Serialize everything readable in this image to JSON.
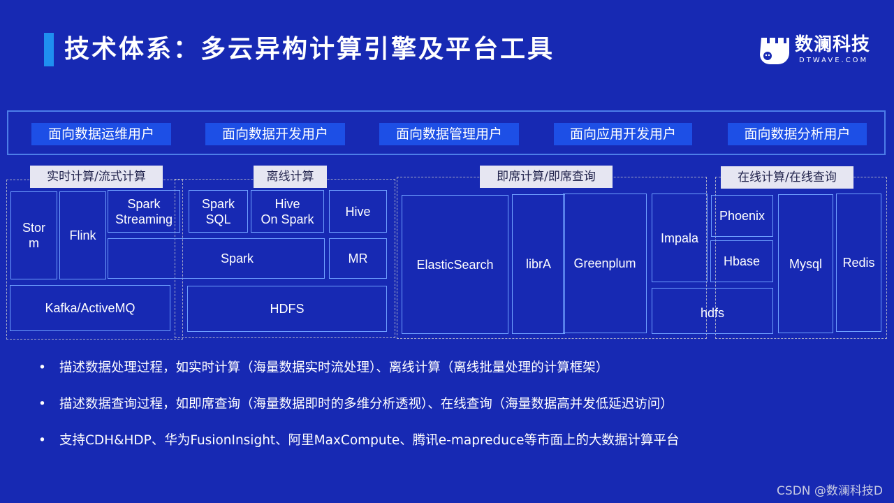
{
  "header": {
    "title": "技术体系：多云异构计算引擎及平台工具",
    "accent_color": "#1f8ff0",
    "logo": {
      "icon": "sloth-logo-icon",
      "name": "数澜科技",
      "domain": "DTWAVE.COM"
    }
  },
  "user_types": [
    "面向数据运维用户",
    "面向数据开发用户",
    "面向数据管理用户",
    "面向应用开发用户",
    "面向数据分析用户"
  ],
  "groups": {
    "realtime": "实时计算/流式计算",
    "offline": "离线计算",
    "adhoc": "即席计算/即席查询",
    "online": "在线计算/在线查询"
  },
  "components": {
    "storm": "Stor\nm",
    "flink": "Flink",
    "spark_streaming": "Spark\nStreaming",
    "spark_sql": "Spark\nSQL",
    "hive_on_spark": "Hive\nOn Spark",
    "hive": "Hive",
    "spark": "Spark",
    "mr": "MR",
    "kafka": "Kafka/ActiveMQ",
    "hdfs": "HDFS",
    "elasticsearch": "ElasticSearch",
    "libra": "librA",
    "greenplum": "Greenplum",
    "impala": "Impala",
    "hdfs_lower": "hdfs",
    "phoenix": "Phoenix",
    "hbase": "Hbase",
    "mysql": "Mysql",
    "redis": "Redis"
  },
  "bullets": [
    "描述数据处理过程，如实时计算（海量数据实时流处理）、离线计算（离线批量处理的计算框架）",
    "描述数据查询过程，如即席查询（海量数据即时的多维分析透视）、在线查询（海量数据高并发低延迟访问）",
    "支持CDH&HDP、华为FusionInsight、阿里MaxCompute、腾讯e-mapreduce等市面上的大数据计算平台"
  ],
  "bullet_symbol": "•",
  "watermark": "CSDN @数澜科技D"
}
